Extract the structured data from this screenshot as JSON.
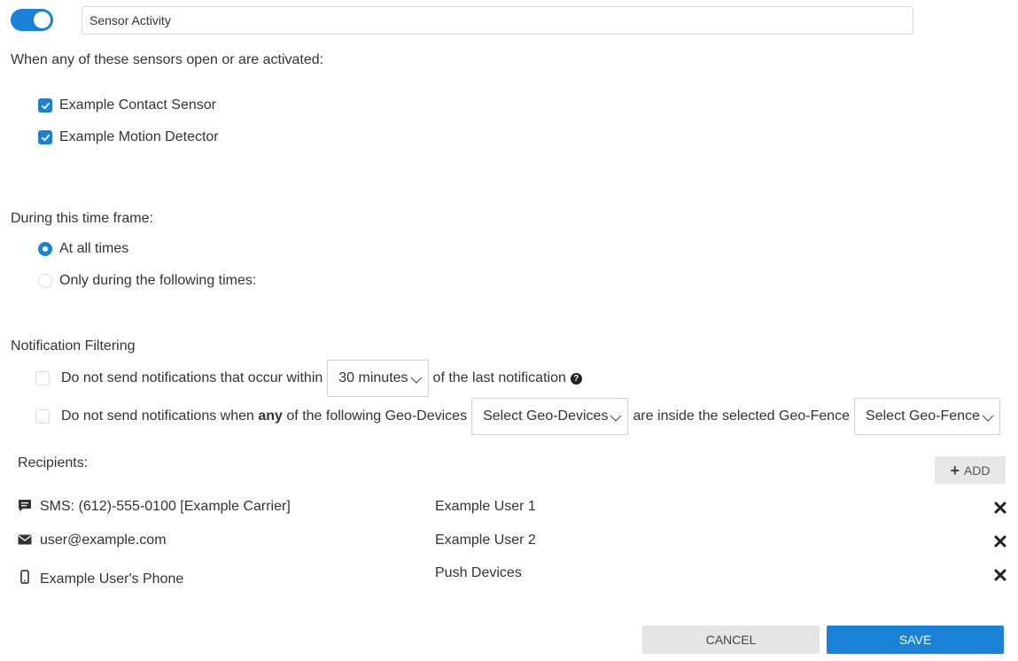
{
  "header": {
    "enabled": true,
    "rule_name": "Sensor Activity"
  },
  "sensors": {
    "label": "When any of these sensors open or are activated:",
    "items": [
      {
        "label": "Example Contact Sensor",
        "checked": true
      },
      {
        "label": "Example Motion Detector",
        "checked": true
      }
    ]
  },
  "timeframe": {
    "label": "During this time frame:",
    "options": [
      {
        "label": "At all times",
        "selected": true
      },
      {
        "label": "Only during the following times:",
        "selected": false
      }
    ]
  },
  "filtering": {
    "label": "Notification Filtering",
    "throttle": {
      "prefix": "Do not send notifications that occur within",
      "interval": "30 minutes",
      "suffix": "of the last notification",
      "checked": false
    },
    "geo": {
      "prefix": "Do not send notifications when",
      "emphasis": "any",
      "mid": "of the following Geo-Devices",
      "devices_select": "Select Geo-Devices",
      "between": "are inside the selected Geo-Fence",
      "fence_select": "Select Geo-Fence",
      "checked": false
    }
  },
  "recipients": {
    "label": "Recipients:",
    "add_label": "ADD",
    "items": [
      {
        "icon": "sms-icon",
        "target": "SMS: (612)-555-0100 [Example Carrier]",
        "user": "Example User 1"
      },
      {
        "icon": "email-icon",
        "target": "user@example.com",
        "user": "Example User 2"
      },
      {
        "icon": "phone-icon",
        "target": "Example User's Phone",
        "user": "Push Devices"
      }
    ]
  },
  "footer": {
    "cancel_label": "CANCEL",
    "save_label": "SAVE"
  },
  "colors": {
    "accent": "#1a82d6",
    "neutral_button": "#e5e5e5"
  }
}
